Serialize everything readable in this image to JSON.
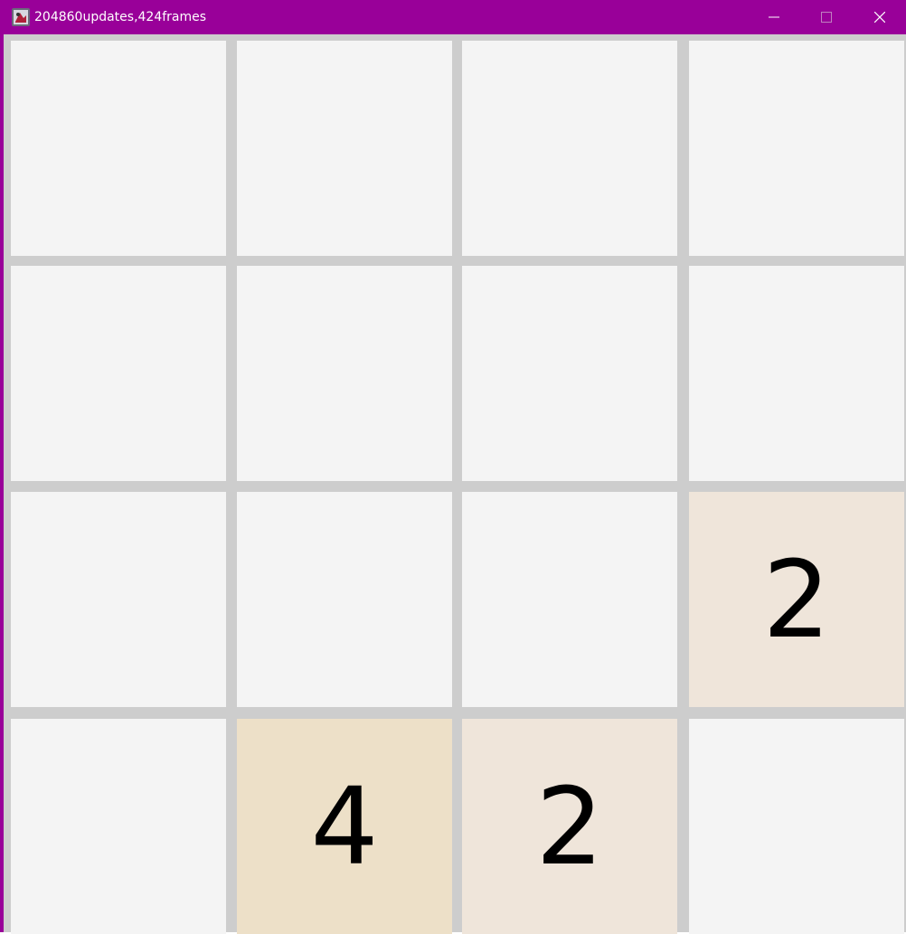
{
  "window": {
    "title": "204860updates,424frames",
    "title_color": "#990099"
  },
  "icons": {
    "app": "app-icon",
    "minimize": "minimize-icon",
    "maximize": "maximize-icon",
    "close": "close-icon"
  },
  "board": {
    "size": 4,
    "grid_color": "#cdcdcd",
    "empty_color": "#f4f4f4",
    "tile_colors": {
      "2": "#efe5da",
      "4": "#ede0c8"
    },
    "cells": [
      [
        "",
        "",
        "",
        ""
      ],
      [
        "",
        "",
        "",
        ""
      ],
      [
        "",
        "",
        "",
        "2"
      ],
      [
        "",
        "4",
        "2",
        ""
      ]
    ]
  }
}
